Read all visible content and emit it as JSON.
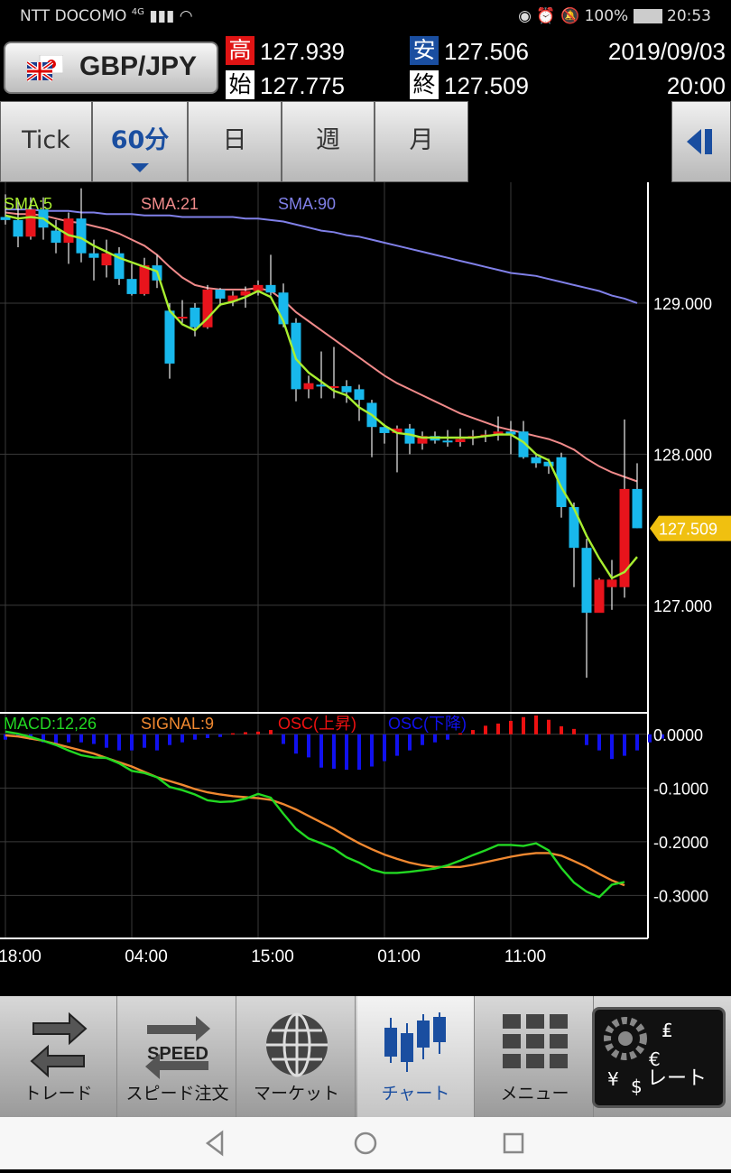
{
  "status_bar": {
    "carrier": "NTT DOCOMO",
    "network": "4G",
    "battery": "100%",
    "time": "20:53"
  },
  "header": {
    "pair": "GBP/JPY",
    "high_label": "高",
    "high": "127.939",
    "open_label": "始",
    "open": "127.775",
    "low_label": "安",
    "low": "127.506",
    "close_label": "終",
    "close": "127.509",
    "date": "2019/09/03",
    "time": "20:00"
  },
  "timeframe_tabs": [
    {
      "label": "Tick",
      "active": false
    },
    {
      "label": "60分",
      "active": true
    },
    {
      "label": "日",
      "active": false
    },
    {
      "label": "週",
      "active": false
    },
    {
      "label": "月",
      "active": false
    }
  ],
  "bottom_nav": [
    {
      "label": "トレード",
      "icon": "trade-icon"
    },
    {
      "label": "スピード注文",
      "icon": "speed-order-icon",
      "icon_text": "SPEED"
    },
    {
      "label": "マーケット",
      "icon": "market-globe-icon"
    },
    {
      "label": "チャート",
      "icon": "chart-icon",
      "active": true
    },
    {
      "label": "メニュー",
      "icon": "menu-grid-icon"
    },
    {
      "label": "レート",
      "icon": "rate-gear-icon"
    }
  ],
  "colors": {
    "up_candle": "#e8141c",
    "down_candle": "#18b8ec",
    "sma5": "#a8ee30",
    "sma21": "#f08a8a",
    "sma90": "#8080e8",
    "macd": "#22d822",
    "signal": "#f08830",
    "osc_up": "#ee1111",
    "osc_down": "#1111ee",
    "price_tag": "#f0c010"
  },
  "chart_data": [
    {
      "type": "candlestick",
      "legend": [
        {
          "name": "SMA:5",
          "key": "sma5"
        },
        {
          "name": "SMA:21",
          "key": "sma21"
        },
        {
          "name": "SMA:90",
          "key": "sma90"
        }
      ],
      "ylim": [
        126.3,
        129.8
      ],
      "y_ticks": [
        "129.000",
        "128.000",
        "127.000"
      ],
      "y_tick_values": [
        129.0,
        128.0,
        127.0
      ],
      "current_price": "127.509",
      "current_value": 127.509,
      "x_labels": [
        "18:00",
        "04:00",
        "15:00",
        "01:00",
        "11:00"
      ],
      "x_label_index": [
        0,
        10,
        20,
        30,
        40
      ],
      "candles": [
        [
          129.57,
          129.55,
          129.72,
          129.52
        ],
        [
          129.55,
          129.44,
          129.69,
          129.37
        ],
        [
          129.44,
          129.62,
          129.7,
          129.42
        ],
        [
          129.62,
          129.5,
          129.7,
          129.42
        ],
        [
          129.48,
          129.4,
          129.55,
          129.33
        ],
        [
          129.4,
          129.56,
          129.6,
          129.26
        ],
        [
          129.56,
          129.33,
          129.76,
          129.27
        ],
        [
          129.33,
          129.3,
          129.42,
          129.15
        ],
        [
          129.25,
          129.33,
          129.42,
          129.17
        ],
        [
          129.33,
          129.16,
          129.37,
          129.12
        ],
        [
          129.16,
          129.06,
          129.26,
          129.05
        ],
        [
          129.06,
          129.25,
          129.3,
          129.05
        ],
        [
          129.25,
          129.15,
          129.32,
          129.1
        ],
        [
          128.95,
          128.6,
          129.0,
          128.5
        ],
        [
          128.9,
          128.91,
          129.02,
          128.87
        ],
        [
          128.97,
          128.84,
          129.0,
          128.78
        ],
        [
          128.84,
          129.09,
          129.12,
          128.83
        ],
        [
          129.09,
          129.03,
          129.1,
          128.98
        ],
        [
          129.01,
          129.05,
          129.08,
          128.98
        ],
        [
          129.05,
          129.08,
          129.11,
          128.97
        ],
        [
          129.08,
          129.12,
          129.15,
          129.05
        ],
        [
          129.12,
          129.07,
          129.32,
          129.05
        ],
        [
          129.07,
          128.86,
          129.13,
          128.84
        ],
        [
          128.87,
          128.43,
          128.9,
          128.35
        ],
        [
          128.43,
          128.47,
          128.52,
          128.37
        ],
        [
          128.46,
          128.45,
          128.68,
          128.37
        ],
        [
          128.45,
          128.45,
          128.71,
          128.37
        ],
        [
          128.45,
          128.41,
          128.49,
          128.34
        ],
        [
          128.43,
          128.36,
          128.46,
          128.22
        ],
        [
          128.34,
          128.18,
          128.36,
          127.98
        ],
        [
          128.18,
          128.14,
          128.2,
          128.07
        ],
        [
          128.14,
          128.17,
          128.19,
          127.88
        ],
        [
          128.17,
          128.07,
          128.2,
          128.0
        ],
        [
          128.07,
          128.12,
          128.15,
          128.03
        ],
        [
          128.12,
          128.09,
          128.15,
          128.07
        ],
        [
          128.09,
          128.08,
          128.16,
          128.05
        ],
        [
          128.08,
          128.1,
          128.17,
          128.05
        ],
        [
          128.11,
          128.12,
          128.16,
          128.06
        ],
        [
          128.12,
          128.13,
          128.16,
          128.08
        ],
        [
          128.13,
          128.15,
          128.25,
          128.09
        ],
        [
          128.15,
          128.13,
          128.22,
          128.0
        ],
        [
          128.15,
          127.98,
          128.22,
          127.97
        ],
        [
          127.98,
          127.94,
          128.0,
          127.91
        ],
        [
          127.95,
          127.92,
          127.97,
          127.87
        ],
        [
          127.98,
          127.65,
          128.01,
          127.58
        ],
        [
          127.65,
          127.38,
          127.68,
          127.12
        ],
        [
          127.38,
          126.95,
          127.44,
          126.52
        ],
        [
          126.95,
          127.17,
          127.18,
          126.96
        ],
        [
          127.12,
          127.17,
          127.3,
          126.97
        ],
        [
          127.12,
          127.77,
          128.23,
          127.05
        ],
        [
          127.77,
          127.51,
          127.94,
          127.51
        ]
      ],
      "sma5": [
        129.58,
        129.56,
        129.57,
        129.56,
        129.5,
        129.45,
        129.43,
        129.38,
        129.34,
        129.3,
        129.27,
        129.24,
        129.21,
        128.95,
        128.86,
        128.82,
        128.9,
        128.99,
        129.01,
        129.04,
        129.08,
        129.04,
        128.88,
        128.63,
        128.54,
        128.48,
        128.42,
        128.39,
        128.31,
        128.26,
        128.19,
        128.14,
        128.13,
        128.11,
        128.11,
        128.11,
        128.11,
        128.11,
        128.12,
        128.13,
        128.13,
        128.08,
        128.0,
        127.96,
        127.78,
        127.64,
        127.46,
        127.31,
        127.18,
        127.22,
        127.32
      ],
      "sma21": [
        129.6,
        129.59,
        129.59,
        129.58,
        129.56,
        129.54,
        129.53,
        129.51,
        129.49,
        129.46,
        129.42,
        129.38,
        129.32,
        129.24,
        129.17,
        129.12,
        129.1,
        129.09,
        129.09,
        129.09,
        129.1,
        129.08,
        129.02,
        128.94,
        128.88,
        128.82,
        128.76,
        128.7,
        128.64,
        128.58,
        128.52,
        128.47,
        128.43,
        128.39,
        128.35,
        128.31,
        128.27,
        128.24,
        128.21,
        128.18,
        128.16,
        128.14,
        128.12,
        128.1,
        128.07,
        128.03,
        127.97,
        127.92,
        127.88,
        127.85,
        127.82
      ],
      "sma90": [
        129.62,
        129.62,
        129.62,
        129.61,
        129.61,
        129.61,
        129.6,
        129.6,
        129.59,
        129.59,
        129.59,
        129.58,
        129.58,
        129.58,
        129.57,
        129.57,
        129.57,
        129.57,
        129.57,
        129.56,
        129.56,
        129.55,
        129.54,
        129.52,
        129.5,
        129.48,
        129.47,
        129.45,
        129.44,
        129.42,
        129.4,
        129.38,
        129.36,
        129.34,
        129.32,
        129.3,
        129.28,
        129.26,
        129.24,
        129.22,
        129.2,
        129.19,
        129.18,
        129.16,
        129.14,
        129.12,
        129.1,
        129.08,
        129.05,
        129.03,
        129.0
      ]
    },
    {
      "type": "macd",
      "legend": [
        {
          "name": "MACD:12,26",
          "key": "macd"
        },
        {
          "name": "SIGNAL:9",
          "key": "signal"
        },
        {
          "name": "OSC(上昇)",
          "key": "osc_up"
        },
        {
          "name": "OSC(下降)",
          "key": "osc_down"
        }
      ],
      "ylim": [
        -0.38,
        0.04
      ],
      "y_ticks": [
        "0.0000",
        "-0.1000",
        "-0.2000",
        "-0.3000"
      ],
      "y_tick_values": [
        0.0,
        -0.1,
        -0.2,
        -0.3
      ],
      "macd": [
        0.005,
        0.001,
        -0.005,
        -0.012,
        -0.02,
        -0.03,
        -0.039,
        -0.043,
        -0.044,
        -0.054,
        -0.068,
        -0.072,
        -0.08,
        -0.098,
        -0.104,
        -0.112,
        -0.123,
        -0.126,
        -0.125,
        -0.12,
        -0.111,
        -0.118,
        -0.148,
        -0.176,
        -0.194,
        -0.203,
        -0.213,
        -0.229,
        -0.239,
        -0.252,
        -0.258,
        -0.258,
        -0.256,
        -0.253,
        -0.25,
        -0.244,
        -0.235,
        -0.225,
        -0.216,
        -0.206,
        -0.206,
        -0.208,
        -0.203,
        -0.216,
        -0.249,
        -0.276,
        -0.293,
        -0.303,
        -0.28,
        -0.275
      ],
      "signal": [
        -0.002,
        -0.004,
        -0.008,
        -0.012,
        -0.018,
        -0.024,
        -0.03,
        -0.036,
        -0.044,
        -0.052,
        -0.06,
        -0.07,
        -0.08,
        -0.087,
        -0.094,
        -0.102,
        -0.108,
        -0.112,
        -0.115,
        -0.117,
        -0.119,
        -0.122,
        -0.13,
        -0.14,
        -0.152,
        -0.164,
        -0.176,
        -0.19,
        -0.203,
        -0.214,
        -0.224,
        -0.232,
        -0.239,
        -0.244,
        -0.247,
        -0.247,
        -0.247,
        -0.243,
        -0.238,
        -0.233,
        -0.228,
        -0.224,
        -0.221,
        -0.221,
        -0.226,
        -0.236,
        -0.247,
        -0.26,
        -0.272,
        -0.281
      ],
      "osc": [
        -0.01,
        -0.005,
        -0.01,
        -0.015,
        -0.02,
        -0.015,
        -0.015,
        -0.018,
        -0.025,
        -0.03,
        -0.03,
        -0.025,
        -0.03,
        -0.02,
        -0.015,
        -0.01,
        -0.007,
        -0.005,
        0.002,
        0.004,
        0.005,
        0.008,
        -0.018,
        -0.036,
        -0.043,
        -0.062,
        -0.064,
        -0.066,
        -0.066,
        -0.06,
        -0.05,
        -0.04,
        -0.03,
        -0.02,
        -0.015,
        -0.01,
        0.002,
        0.008,
        0.016,
        0.02,
        0.025,
        0.032,
        0.035,
        0.027,
        0.015,
        0.01,
        -0.02,
        -0.03,
        -0.046,
        -0.04,
        -0.03,
        -0.015,
        -0.008
      ]
    }
  ]
}
